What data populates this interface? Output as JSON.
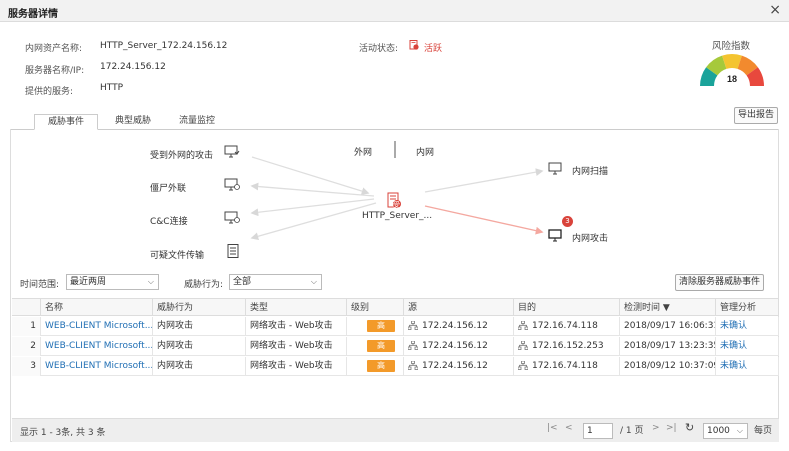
{
  "dialog": {
    "title": "服务器详情",
    "close": "×"
  },
  "info": {
    "asset_name_label": "内网资产名称:",
    "asset_name_value": "HTTP_Server_172.24.156.12",
    "server_label": "服务器名称/IP:",
    "server_value": "172.24.156.12",
    "service_label": "提供的服务:",
    "service_value": "HTTP",
    "status_label": "活动状态:",
    "status_value": "活跃"
  },
  "risk": {
    "label": "风险指数",
    "value": "18",
    "colors": [
      "#1aa39a",
      "#a6c93b",
      "#f4c430",
      "#f28a2e",
      "#e8483d"
    ]
  },
  "export_button": "导出报告",
  "tabs": [
    {
      "label": "威胁事件",
      "active": true
    },
    {
      "label": "典型威胁",
      "active": false
    },
    {
      "label": "流量监控",
      "active": false
    }
  ],
  "topology": {
    "external": "外网",
    "internal": "内网",
    "left_items": [
      "受到外网的攻击",
      "僵尸外联",
      "C&C连接",
      "可疑文件传输"
    ],
    "center": "HTTP_Server_...",
    "center_icon_text": "受",
    "right_items": [
      "内网扫描",
      "内网攻击"
    ],
    "attack_badge": "3"
  },
  "filters": {
    "time_label": "时间范围:",
    "time_value": "最近两周",
    "behavior_label": "威胁行为:",
    "behavior_value": "全部",
    "clear_button": "清除服务器威胁事件"
  },
  "table": {
    "headers": [
      "名称",
      "威胁行为",
      "类型",
      "级别",
      "源",
      "目的",
      "检测时间 ▼",
      "管理分析"
    ],
    "rows": [
      {
        "idx": "1",
        "name": "WEB-CLIENT Microsoft...",
        "behavior": "内网攻击",
        "type": "网络攻击 - Web攻击",
        "level": "高",
        "src": "172.24.156.12",
        "dst": "172.16.74.118",
        "time": "2018/09/17 16:06:31",
        "analysis": "未确认"
      },
      {
        "idx": "2",
        "name": "WEB-CLIENT Microsoft...",
        "behavior": "内网攻击",
        "type": "网络攻击 - Web攻击",
        "level": "高",
        "src": "172.24.156.12",
        "dst": "172.16.152.253",
        "time": "2018/09/17 13:23:35",
        "analysis": "未确认"
      },
      {
        "idx": "3",
        "name": "WEB-CLIENT Microsoft...",
        "behavior": "内网攻击",
        "type": "网络攻击 - Web攻击",
        "level": "高",
        "src": "172.24.156.12",
        "dst": "172.16.74.118",
        "time": "2018/09/12 10:37:09",
        "analysis": "未确认"
      }
    ]
  },
  "footer": {
    "summary": "显示 1 - 3条, 共 3 条",
    "page": "1",
    "total_pages": "/ 1 页",
    "page_size": "1000",
    "per_page": "每页"
  }
}
